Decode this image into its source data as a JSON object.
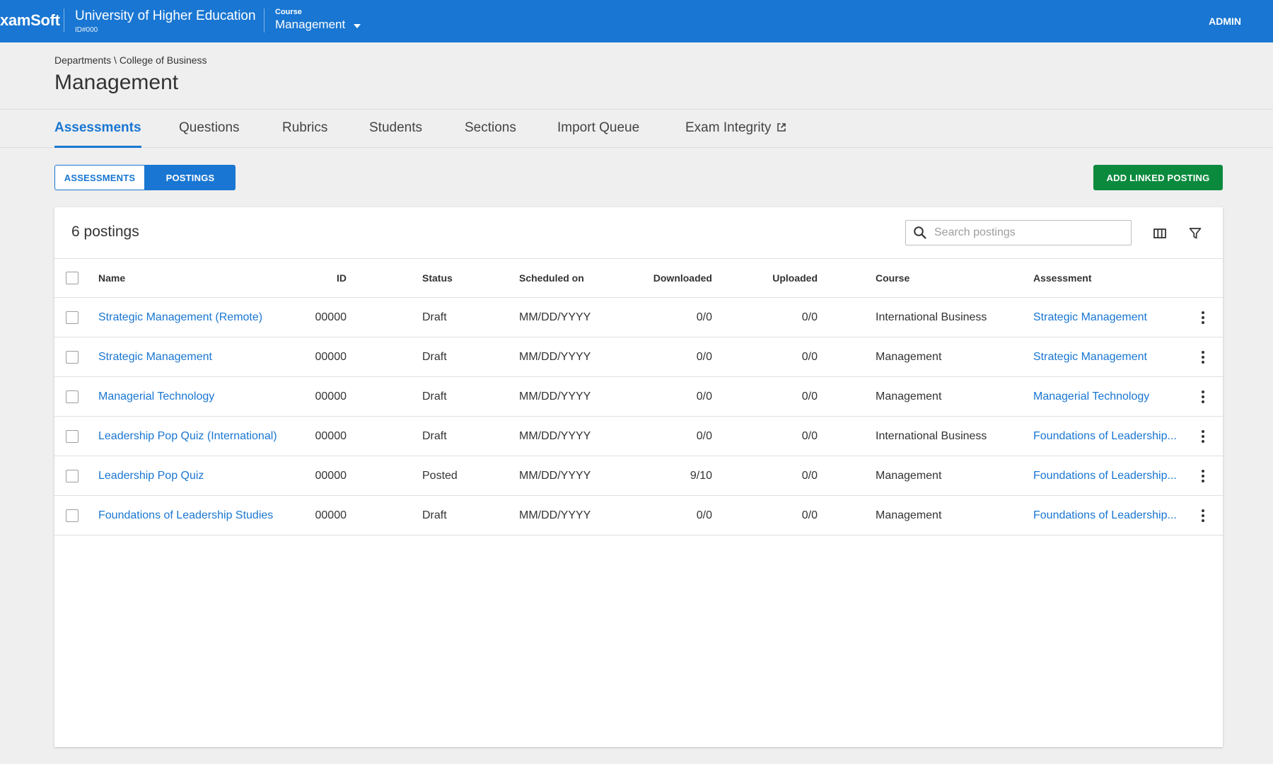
{
  "header": {
    "logo": "xamSoft",
    "institution": "University of Higher Education",
    "institution_id": "ID#000",
    "course_label": "Course",
    "course_value": "Management",
    "user": "ADMIN",
    "color": "#1976d2"
  },
  "breadcrumb": "Departments \\ College of Business",
  "page_title": "Management",
  "tabs": [
    {
      "label": "Assessments",
      "active": true
    },
    {
      "label": "Questions"
    },
    {
      "label": "Rubrics"
    },
    {
      "label": "Students"
    },
    {
      "label": "Sections"
    },
    {
      "label": "Import Queue"
    },
    {
      "label": "Exam Integrity",
      "icon": "external-link-icon"
    }
  ],
  "toggle": {
    "assessments": "ASSESSMENTS",
    "postings": "POSTINGS",
    "selected": "POSTINGS"
  },
  "add_button": {
    "label": "ADD LINKED POSTING",
    "color": "#0b8a3e"
  },
  "table": {
    "count_label": "6 postings",
    "search_placeholder": "Search postings",
    "icons": [
      "search-icon",
      "columns-icon",
      "filter-icon",
      "more-vert-icon"
    ],
    "columns": [
      "Name",
      "ID",
      "Status",
      "Scheduled on",
      "Downloaded",
      "Uploaded",
      "Course",
      "Assessment"
    ],
    "rows": [
      {
        "name": "Strategic Management (Remote)",
        "id": "00000",
        "status": "Draft",
        "scheduled": "MM/DD/YYYY",
        "downloaded": "0/0",
        "uploaded": "0/0",
        "course": "International Business",
        "assessment": "Strategic Management"
      },
      {
        "name": "Strategic Management",
        "id": "00000",
        "status": "Draft",
        "scheduled": "MM/DD/YYYY",
        "downloaded": "0/0",
        "uploaded": "0/0",
        "course": "Management",
        "assessment": "Strategic Management"
      },
      {
        "name": "Managerial Technology",
        "id": "00000",
        "status": "Draft",
        "scheduled": "MM/DD/YYYY",
        "downloaded": "0/0",
        "uploaded": "0/0",
        "course": "Management",
        "assessment": "Managerial Technology"
      },
      {
        "name": "Leadership Pop Quiz (International)",
        "id": "00000",
        "status": "Draft",
        "scheduled": "MM/DD/YYYY",
        "downloaded": "0/0",
        "uploaded": "0/0",
        "course": "International Business",
        "assessment": "Foundations of Leadership..."
      },
      {
        "name": "Leadership Pop Quiz",
        "id": "00000",
        "status": "Posted",
        "scheduled": "MM/DD/YYYY",
        "downloaded": "9/10",
        "uploaded": "0/0",
        "course": "Management",
        "assessment": "Foundations of Leadership..."
      },
      {
        "name": "Foundations of Leadership Studies",
        "id": "00000",
        "status": "Draft",
        "scheduled": "MM/DD/YYYY",
        "downloaded": "0/0",
        "uploaded": "0/0",
        "course": "Management",
        "assessment": "Foundations of Leadership..."
      }
    ]
  }
}
